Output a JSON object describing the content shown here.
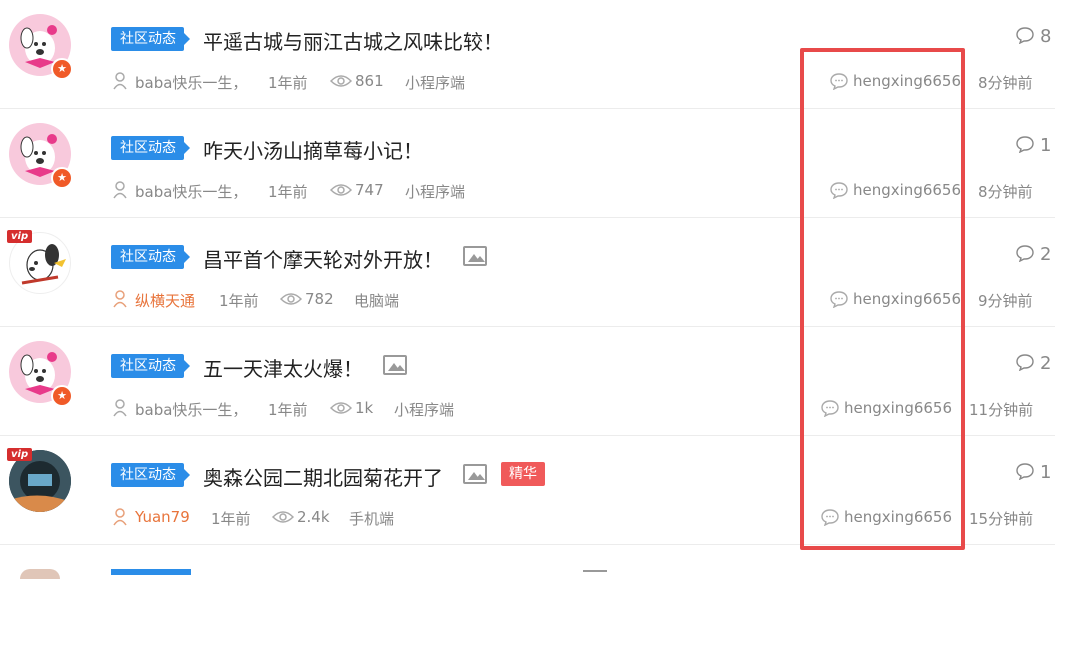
{
  "topics": [
    {
      "category": "社区动态",
      "title": "平遥古城与丽江古城之风味比较！",
      "author": "baba快乐一生，",
      "time": "1年前",
      "views": "861",
      "source": "小程序端",
      "last_reply_user": "hengxing6656",
      "last_reply_time": "8分钟前",
      "reply_count": "8"
    },
    {
      "category": "社区动态",
      "title": "咋天小汤山摘草莓小记！",
      "author": "baba快乐一生，",
      "time": "1年前",
      "views": "747",
      "source": "小程序端",
      "last_reply_user": "hengxing6656",
      "last_reply_time": "8分钟前",
      "reply_count": "1"
    },
    {
      "category": "社区动态",
      "title": "昌平首个摩天轮对外开放！",
      "author": "纵横天通",
      "time": "1年前",
      "views": "782",
      "source": "电脑端",
      "last_reply_user": "hengxing6656",
      "last_reply_time": "9分钟前",
      "reply_count": "2"
    },
    {
      "category": "社区动态",
      "title": "五一天津太火爆！",
      "author": "baba快乐一生，",
      "time": "1年前",
      "views": "1k",
      "source": "小程序端",
      "last_reply_user": "hengxing6656",
      "last_reply_time": "11分钟前",
      "reply_count": "2"
    },
    {
      "category": "社区动态",
      "title": "奥森公园二期北园菊花开了",
      "essence_label": "精华",
      "author": "Yuan79",
      "time": "1年前",
      "views": "2.4k",
      "source": "手机端",
      "last_reply_user": "hengxing6656",
      "last_reply_time": "15分钟前",
      "reply_count": "1"
    }
  ],
  "badges": {
    "vip": "vip",
    "level": "★"
  },
  "icons": {
    "user": "user-icon",
    "views": "eye-icon",
    "reply": "comment-bubble-icon",
    "image": "image-icon"
  },
  "colors": {
    "category_tag": "#2b8de8",
    "essence_tag": "#f05a5a",
    "highlight_box": "#e84a4a",
    "vip_author": "#e8743b"
  }
}
